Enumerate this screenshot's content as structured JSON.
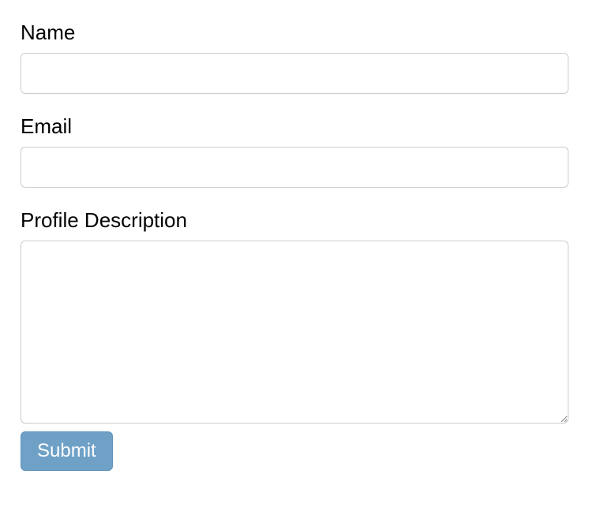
{
  "form": {
    "name": {
      "label": "Name",
      "value": ""
    },
    "email": {
      "label": "Email",
      "value": ""
    },
    "profile": {
      "label": "Profile Description",
      "value": ""
    },
    "submit_label": "Submit"
  }
}
